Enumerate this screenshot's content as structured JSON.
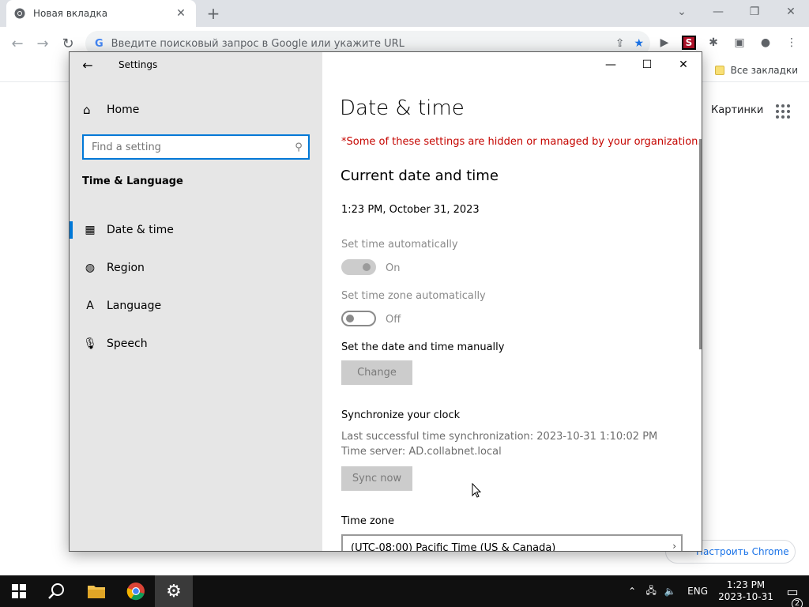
{
  "chrome": {
    "tab_title": "Новая вкладка",
    "tab_close": "✕",
    "new_tab": "+",
    "omnibox_placeholder": "Введите поисковый запрос в Google или укажите URL",
    "omnibox_g": "G",
    "all_bookmarks": "Все закладки",
    "images_link": "Картинки",
    "customize_chrome": "Настроить Chrome",
    "ext_letter": "S"
  },
  "settings": {
    "window_title": "Settings",
    "sidebar": {
      "home": "Home",
      "search_placeholder": "Find a setting",
      "section": "Time & Language",
      "items": [
        {
          "label": "Date & time",
          "icon": "calendar-clock-icon",
          "active": true
        },
        {
          "label": "Region",
          "icon": "globe-icon",
          "active": false
        },
        {
          "label": "Language",
          "icon": "language-icon",
          "active": false
        },
        {
          "label": "Speech",
          "icon": "microphone-icon",
          "active": false
        }
      ]
    },
    "content": {
      "title": "Date & time",
      "org_notice": "*Some of these settings are hidden or managed by your organization.",
      "current_heading": "Current date and time",
      "current_datetime": "1:23 PM, October 31, 2023",
      "set_time_auto_label": "Set time automatically",
      "set_time_auto_state": "On",
      "set_tz_auto_label": "Set time zone automatically",
      "set_tz_auto_state": "Off",
      "manual_label": "Set the date and time manually",
      "change_button": "Change",
      "sync_heading": "Synchronize your clock",
      "last_sync": "Last successful time synchronization: 2023-10-31 1:10:02 PM",
      "time_server": "Time server: AD.collabnet.local",
      "sync_button": "Sync now",
      "timezone_label": "Time zone",
      "timezone_value": "(UTC-08:00) Pacific Time (US & Canada)"
    }
  },
  "taskbar": {
    "language": "ENG",
    "time": "1:23 PM",
    "date": "2023-10-31",
    "notifications": "2"
  },
  "colors": {
    "accent": "#0078d7",
    "notice_red": "#c50500",
    "sidebar_bg": "#e6e6e6",
    "taskbar_bg": "#101010"
  }
}
